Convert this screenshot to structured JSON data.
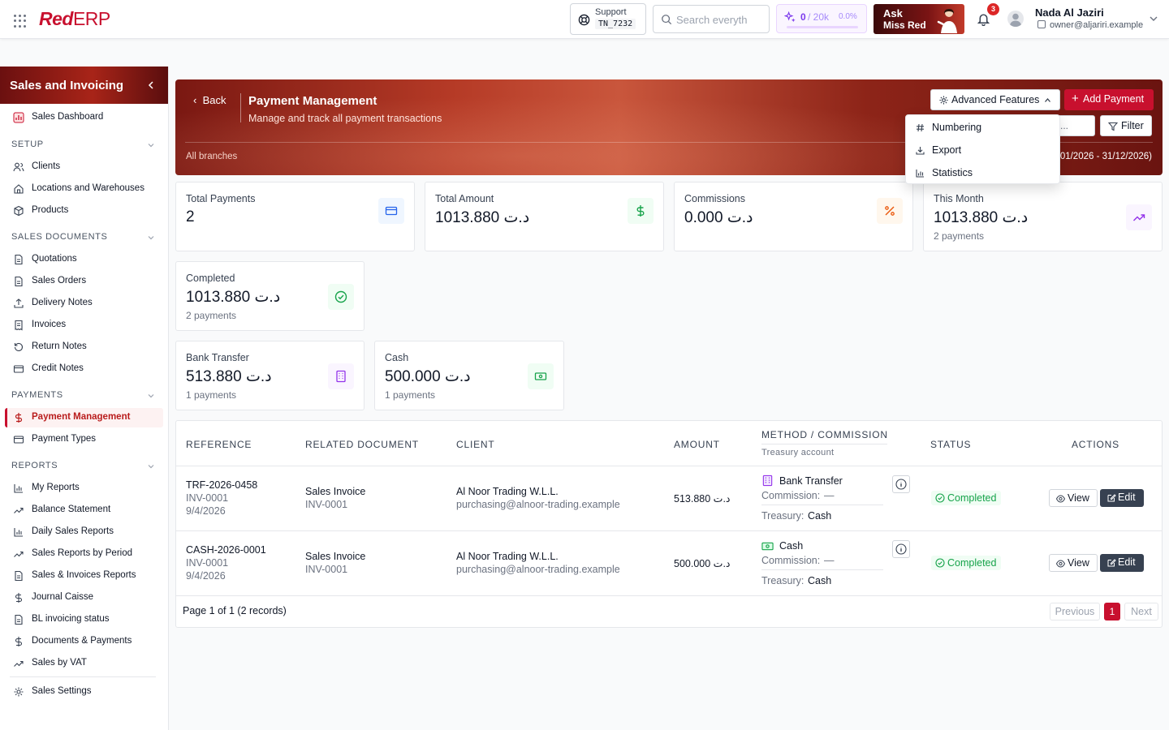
{
  "topbar": {
    "logo_red": "Red",
    "logo_erp": "ERP",
    "support_label": "Support",
    "support_code": "TN_7232",
    "search_placeholder": "Search everyth",
    "credits_used": "0",
    "credits_limit": "/ 20k",
    "credits_pct": "0.0%",
    "ask_line1": "Ask",
    "ask_line2": "Miss Red",
    "notif_count": "3",
    "user_name": "Nada Al Jaziri",
    "user_email": "owner@aljariri.example"
  },
  "sidebar": {
    "title": "Sales and Invoicing",
    "dashboard": "Sales Dashboard",
    "sections": {
      "setup": "SETUP",
      "sales_documents": "SALES DOCUMENTS",
      "payments": "PAYMENTS",
      "reports": "REPORTS"
    },
    "setup_items": [
      "Clients",
      "Locations and Warehouses",
      "Products"
    ],
    "doc_items": [
      "Quotations",
      "Sales Orders",
      "Delivery Notes",
      "Invoices",
      "Return Notes",
      "Credit Notes"
    ],
    "payment_items": [
      "Payment Management",
      "Payment Types"
    ],
    "report_items": [
      "My Reports",
      "Balance Statement",
      "Daily Sales Reports",
      "Sales Reports by Period",
      "Sales & Invoices Reports",
      "Journal Caisse",
      "BL invoicing status",
      "Documents & Payments",
      "Sales by VAT"
    ],
    "settings": "Sales Settings"
  },
  "header": {
    "back": "Back",
    "title": "Payment Management",
    "subtitle": "Manage and track all payment transactions",
    "branches": "All branches",
    "date_range": "01/2026 - 31/12/2026)",
    "advanced_features": "Advanced Features",
    "add_payment": "Add Payment",
    "search_stub": "...",
    "filter": "Filter"
  },
  "dropdown": {
    "items": [
      "Numbering",
      "Export",
      "Statistics"
    ]
  },
  "stats": {
    "total_payments": {
      "title": "Total Payments",
      "value": "2"
    },
    "total_amount": {
      "title": "Total Amount",
      "value": "1013.880 د.ت"
    },
    "commissions": {
      "title": "Commissions",
      "value": "0.000 د.ت"
    },
    "this_month": {
      "title": "This Month",
      "value": "1013.880 د.ت",
      "sub": "2 payments"
    },
    "completed": {
      "title": "Completed",
      "value": "1013.880 د.ت",
      "sub": "2 payments"
    },
    "bank_transfer": {
      "title": "Bank Transfer",
      "value": "513.880 د.ت",
      "sub": "1 payments"
    },
    "cash": {
      "title": "Cash",
      "value": "500.000 د.ت",
      "sub": "1 payments"
    }
  },
  "table": {
    "headers": {
      "reference": "REFERENCE",
      "related": "RELATED DOCUMENT",
      "client": "CLIENT",
      "amount": "AMOUNT",
      "method": "METHOD / COMMISSION",
      "method_sub": "Treasury account",
      "status": "STATUS",
      "actions": "ACTIONS"
    },
    "rows": [
      {
        "ref": "TRF-2026-0458",
        "ref_doc": "INV-0001",
        "date": "9/4/2026",
        "related": "Sales Invoice",
        "related_doc": "INV-0001",
        "client": "Al Noor Trading W.L.L.",
        "client_email": "purchasing@alnoor-trading.example",
        "amount": "513.880 د.ت",
        "method": "Bank Transfer",
        "commission_label": "Commission:",
        "commission_value": "—",
        "treasury_label": "Treasury:",
        "treasury_value": "Cash",
        "status": "Completed",
        "view": "View",
        "edit": "Edit"
      },
      {
        "ref": "CASH-2026-0001",
        "ref_doc": "INV-0001",
        "date": "9/4/2026",
        "related": "Sales Invoice",
        "related_doc": "INV-0001",
        "client": "Al Noor Trading W.L.L.",
        "client_email": "purchasing@alnoor-trading.example",
        "amount": "500.000 د.ت",
        "method": "Cash",
        "commission_label": "Commission:",
        "commission_value": "—",
        "treasury_label": "Treasury:",
        "treasury_value": "Cash",
        "status": "Completed",
        "view": "View",
        "edit": "Edit"
      }
    ],
    "pager_text": "Page 1 of 1 (2 records)",
    "prev": "Previous",
    "page": "1",
    "next": "Next"
  },
  "colors": {
    "brand": "#c8102e",
    "success": "#16a34a",
    "accent_purple": "#7c3aed"
  }
}
